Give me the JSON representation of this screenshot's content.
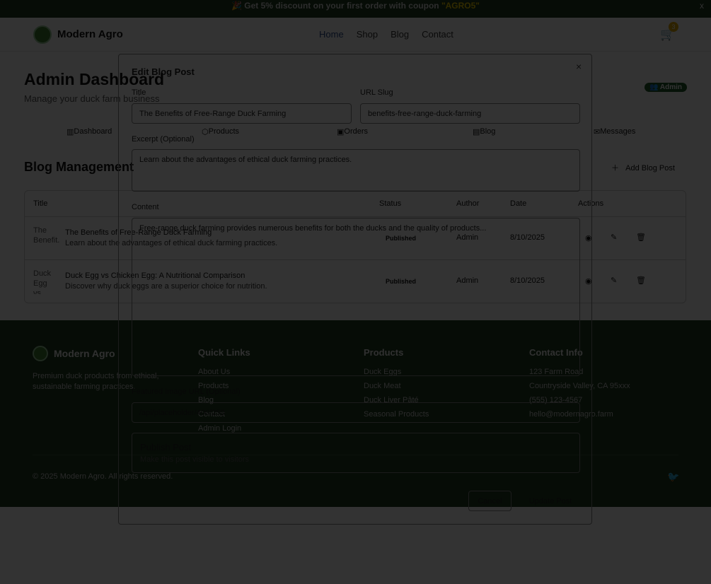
{
  "banner": {
    "prefix": "🎉 Get 5% discount on your first order with coupon ",
    "coupon": "\"AGRO5\"",
    "close": "x"
  },
  "nav": {
    "brand": "Modern Agro",
    "links": [
      "Home",
      "Shop",
      "Blog",
      "Contact"
    ],
    "cart_count": "3"
  },
  "dashboard": {
    "title": "Admin Dashboard",
    "subtitle": "Manage your duck farm business",
    "role_badge": "Admin",
    "tabs": [
      "Dashboard",
      "Products",
      "Orders",
      "Blog",
      "Messages"
    ],
    "section_title": "Blog Management",
    "add_button": "Add Blog Post"
  },
  "table": {
    "headers": [
      "Title",
      "Status",
      "Author",
      "Date",
      "Actions"
    ],
    "rows": [
      {
        "thumb_alt": "The Benefit...",
        "title": "The Benefits of Free-Range Duck Farming",
        "excerpt": "Learn about the advantages of ethical duck farming practices.",
        "status": "Published",
        "author": "Admin",
        "date": "8/10/2025"
      },
      {
        "thumb_alt": "Duck Egg vs...",
        "title": "Duck Egg vs Chicken Egg: A Nutritional Comparison",
        "excerpt": "Discover why duck eggs are a superior choice for nutrition.",
        "status": "Published",
        "author": "Admin",
        "date": "8/10/2025"
      }
    ]
  },
  "footer": {
    "brand": "Modern Agro",
    "tagline": "Premium duck products from ethical, sustainable farming practices.",
    "quick_links": {
      "title": "Quick Links",
      "items": [
        "About Us",
        "Products",
        "Blog",
        "Contact",
        "Admin Login"
      ]
    },
    "products": {
      "title": "Products",
      "items": [
        "Duck Eggs",
        "Duck Meat",
        "Duck Liver Pâté",
        "Seasonal Products"
      ]
    },
    "contact": {
      "title": "Contact Info",
      "items": [
        "123 Farm Road",
        "Countryside Valley, CA 95xxx",
        "(555) 123-4567",
        "hello@modernagro.farm"
      ]
    },
    "copyright": "© 2025 Modern Agro. All rights reserved."
  },
  "modal": {
    "title": "Edit Blog Post",
    "close": "×",
    "title_label": "Title",
    "title_value": "The Benefits of Free-Range Duck Farming",
    "slug_label": "URL Slug",
    "slug_value": "benefits-free-range-duck-farming",
    "excerpt_label": "Excerpt (Optional)",
    "excerpt_value": "Learn about the advantages of ethical duck farming practices.",
    "content_label": "Content",
    "content_value": "Free-range duck farming provides numerous benefits for both the ducks and the quality of products...",
    "image_label": "Featured Image URL (Optional)",
    "image_value": "/api/placeholder/400/250",
    "publish_title": "Publish Post",
    "publish_desc": "Make this post visible to visitors",
    "cancel": "Cancel",
    "submit": "Update Post"
  }
}
